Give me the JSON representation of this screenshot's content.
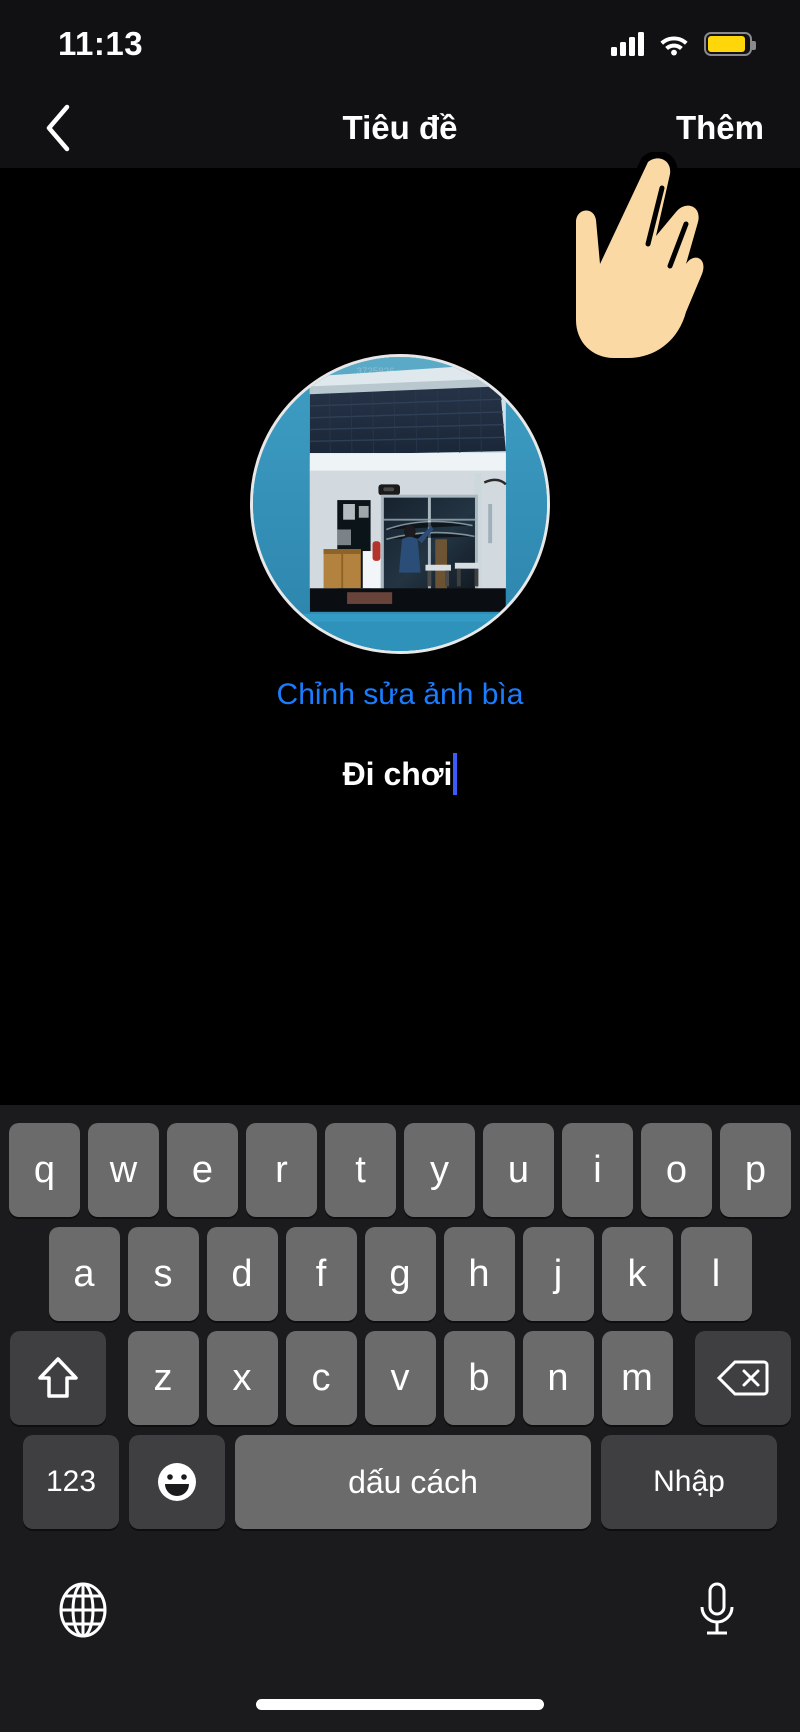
{
  "status_bar": {
    "time": "11:13",
    "signal_icon": "cellular-signal-icon",
    "signal_bars": 4,
    "wifi_icon": "wifi-icon",
    "battery_icon": "battery-icon",
    "battery_color": "#ffd60a",
    "battery_level_percent": 92
  },
  "nav_bar": {
    "back_icon": "chevron-left-icon",
    "title": "Tiêu đề",
    "more_label": "Thêm"
  },
  "content": {
    "avatar_name": "album-cover-avatar",
    "avatar_description": "Ảnh ngôi nhà mái ngói xanh đậm, tường trắng, cửa kính",
    "edit_cover_label": "Chỉnh sửa ảnh bìa",
    "edit_cover_color": "#1a7dff",
    "title_value": "Đi chơi",
    "caret_color": "#3b5bfd"
  },
  "overlay": {
    "hand_cursor_icon": "tap-hand-cursor-icon",
    "hand_skin_color": "#fbd9a5",
    "hand_outline_color": "#000000"
  },
  "keyboard": {
    "language": "vi",
    "row1": [
      "q",
      "w",
      "e",
      "r",
      "t",
      "y",
      "u",
      "i",
      "o",
      "p"
    ],
    "row2": [
      "a",
      "s",
      "d",
      "f",
      "g",
      "h",
      "j",
      "k",
      "l"
    ],
    "row3": [
      "z",
      "x",
      "c",
      "v",
      "b",
      "n",
      "m"
    ],
    "shift_icon": "shift-arrow-icon",
    "backspace_icon": "backspace-delete-icon",
    "numeric_label": "123",
    "emoji_icon": "emoji-smiley-icon",
    "space_label": "dấu cách",
    "enter_label": "Nhập",
    "globe_icon": "globe-language-icon",
    "mic_icon": "microphone-dictation-icon",
    "key_color": "#6b6b6b",
    "modifier_key_color": "#3f3f41",
    "keyboard_background": "#1b1b1d"
  }
}
